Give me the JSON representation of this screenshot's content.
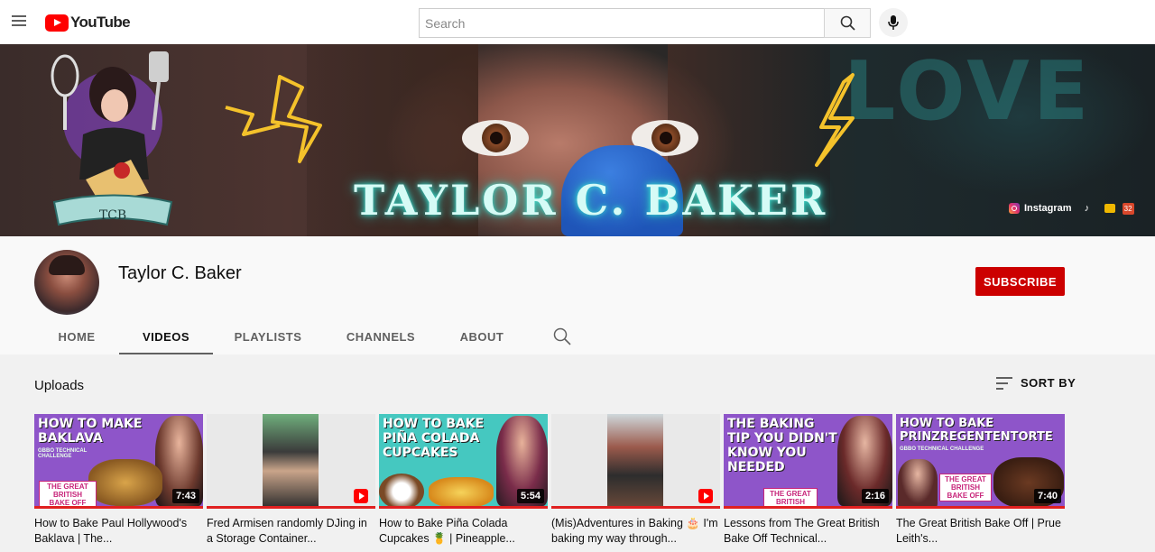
{
  "header": {
    "logo_text": "YouTube",
    "search_placeholder": "Search"
  },
  "banner": {
    "title": "TAYLOR C. BAKER",
    "love_text": "LOVE",
    "logo_badge": "TCB",
    "social": {
      "instagram_label": "Instagram",
      "tiktok_icon": "tiktok-icon",
      "extra_badge": "32"
    }
  },
  "channel": {
    "name": "Taylor C. Baker",
    "subscribe_label": "SUBSCRIBE",
    "tabs": [
      {
        "label": "HOME",
        "active": false
      },
      {
        "label": "VIDEOS",
        "active": true
      },
      {
        "label": "PLAYLISTS",
        "active": false
      },
      {
        "label": "CHANNELS",
        "active": false
      },
      {
        "label": "ABOUT",
        "active": false
      }
    ]
  },
  "uploads": {
    "title": "Uploads",
    "sort_label": "SORT BY",
    "videos": [
      {
        "title": "How to Bake Paul Hollywood's Baklava | The...",
        "duration": "7:43",
        "thumb_text": "HOW TO MAKE BAKLAVA",
        "thumb_sub": "GBBO TECHNICAL CHALLENGE",
        "badge": "THE GREAT BRITISH BAKE OFF",
        "bg": "#8e55c9"
      },
      {
        "title": "Fred Armisen randomly DJing in a Storage Container...",
        "duration": "",
        "short": true,
        "bg": "#e9e9e9"
      },
      {
        "title": "How to Bake Piña Colada Cupcakes 🍍 | Pineapple...",
        "duration": "5:54",
        "thumb_text": "HOW TO BAKE PIÑA COLADA CUPCAKES",
        "bg": "#45c8c0"
      },
      {
        "title": "(Mis)Adventures in Baking 🎂 I'm baking my way through...",
        "duration": "",
        "short": true,
        "bg": "#e9e9e9"
      },
      {
        "title": "Lessons from The Great British Bake Off Technical...",
        "duration": "2:16",
        "thumb_text": "THE BAKING TIP YOU DIDN'T KNOW YOU NEEDED",
        "badge": "THE GREAT BRITISH BAKE OFF",
        "bg": "#8e55c9"
      },
      {
        "title": "The Great British Bake Off | Prue Leith's...",
        "duration": "7:40",
        "thumb_text": "HOW TO BAKE PRINZREGENTENTORTE",
        "thumb_sub": "GBBO TECHNICAL CHALLENGE",
        "badge": "THE GREAT BRITISH BAKE OFF",
        "bg": "#8e55c9"
      }
    ]
  },
  "colors": {
    "brand_red": "#ff0000",
    "subscribe_red": "#cc0000",
    "neon_cyan": "#37e4d4",
    "purple": "#8e55c9",
    "teal": "#45c8c0"
  }
}
